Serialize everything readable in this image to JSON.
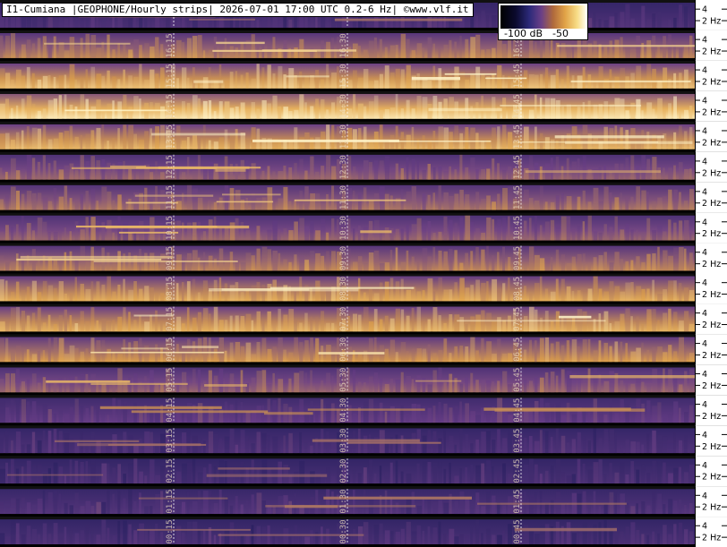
{
  "title": "I1-Cumiana |GEOPHONE/Hourly strips| 2026-07-01 17:00 UTC 0.2-6 Hz| ©www.vlf.it",
  "legend": {
    "min_label": "-100 dB",
    "max_label": "-50"
  },
  "chart_data": {
    "type": "heatmap",
    "x_quantity": "minutes past the hour (UTC)",
    "y_quantity": "frequency (Hz)",
    "frequency_range_hz": [
      0.2,
      6
    ],
    "colorbar_db_range": [
      -100,
      -50
    ],
    "right_axis_ticks": [
      "4",
      "2 Hz"
    ],
    "strips": [
      {
        "hour": 17,
        "marker_labels": [
          "",
          "",
          ""
        ],
        "intensity": 0.2
      },
      {
        "hour": 16,
        "marker_labels": [
          "16:15",
          "16:30",
          "16:45"
        ],
        "intensity": 0.55
      },
      {
        "hour": 15,
        "marker_labels": [
          "15:15",
          "15:30",
          "15:45"
        ],
        "intensity": 0.75
      },
      {
        "hour": 14,
        "marker_labels": [
          "14:15",
          "14:30",
          "14:45"
        ],
        "intensity": 0.9
      },
      {
        "hour": 13,
        "marker_labels": [
          "13:15",
          "13:30",
          "13:45"
        ],
        "intensity": 0.72
      },
      {
        "hour": 12,
        "marker_labels": [
          "12:15",
          "12:30",
          "12:45"
        ],
        "intensity": 0.45
      },
      {
        "hour": 11,
        "marker_labels": [
          "11:15",
          "11:30",
          "11:45"
        ],
        "intensity": 0.5
      },
      {
        "hour": 10,
        "marker_labels": [
          "10:15",
          "10:30",
          "10:45"
        ],
        "intensity": 0.45
      },
      {
        "hour": 9,
        "marker_labels": [
          "09:15",
          "09:30",
          "09:45"
        ],
        "intensity": 0.55
      },
      {
        "hour": 8,
        "marker_labels": [
          "08:15",
          "08:30",
          "08:45"
        ],
        "intensity": 0.68
      },
      {
        "hour": 7,
        "marker_labels": [
          "07:15",
          "07:30",
          "07:45"
        ],
        "intensity": 0.7
      },
      {
        "hour": 6,
        "marker_labels": [
          "06:15",
          "06:30",
          "06:45"
        ],
        "intensity": 0.62
      },
      {
        "hour": 5,
        "marker_labels": [
          "05:15",
          "05:30",
          "05:45"
        ],
        "intensity": 0.45
      },
      {
        "hour": 4,
        "marker_labels": [
          "04:15",
          "04:30",
          "04:45"
        ],
        "intensity": 0.3
      },
      {
        "hour": 3,
        "marker_labels": [
          "03:15",
          "03:30",
          "03:45"
        ],
        "intensity": 0.2
      },
      {
        "hour": 2,
        "marker_labels": [
          "02:15",
          "02:30",
          "02:45"
        ],
        "intensity": 0.18
      },
      {
        "hour": 1,
        "marker_labels": [
          "01:15",
          "01:30",
          "01:45"
        ],
        "intensity": 0.22
      },
      {
        "hour": 0,
        "marker_labels": [
          "00:15",
          "00:30",
          "00:45"
        ],
        "intensity": 0.18
      }
    ],
    "colors": {
      "background": "#000000",
      "low": "#221d5c",
      "mid": "#6a3f87",
      "high": "#e1a347",
      "peak": "#fff4c8",
      "gridline": "#ffffff"
    }
  }
}
